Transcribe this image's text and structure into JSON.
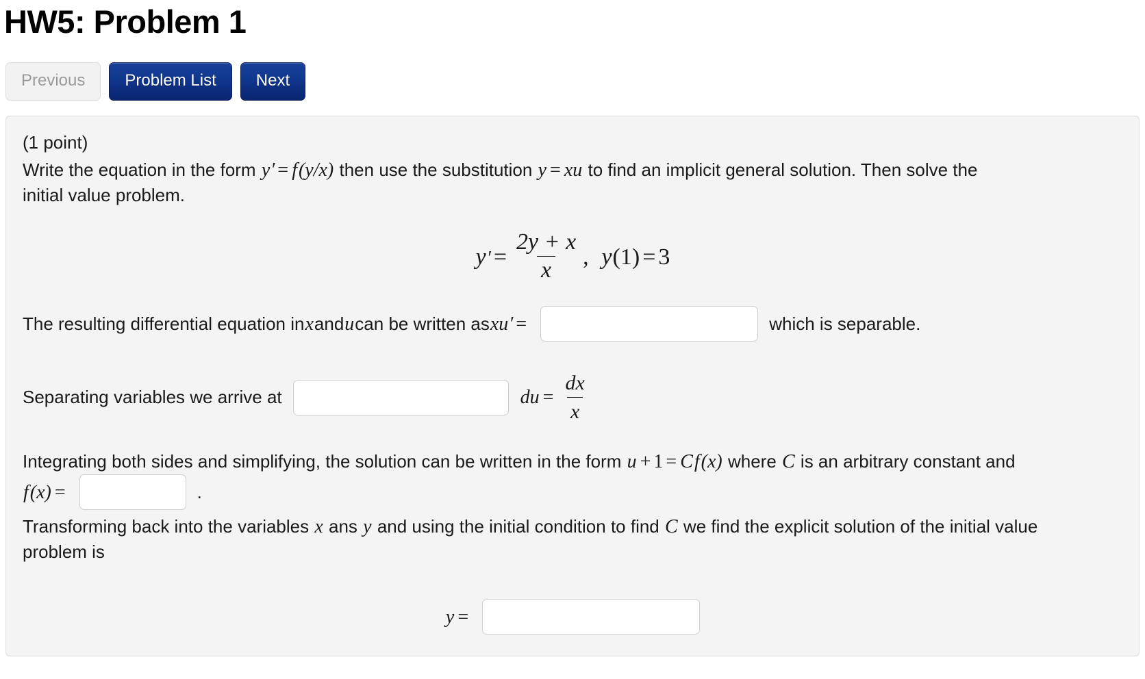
{
  "header": {
    "title": "HW5: Problem 1"
  },
  "nav": {
    "previous_label": "Previous",
    "problem_list_label": "Problem List",
    "next_label": "Next",
    "primary_color": "#0c2d80",
    "disabled_text_color": "#9b9b9b"
  },
  "problem": {
    "points": "(1 point)",
    "intro_part1": "Write the equation in the form ",
    "intro_math1_y": "y",
    "intro_math1_prime": "′",
    "intro_math1_eq": "=",
    "intro_math1_f": "f",
    "intro_math1_arg": "(y/x)",
    "intro_part2": " then use the substitution ",
    "intro_math2_y": "y",
    "intro_math2_eq": "=",
    "intro_math2_xu": "xu",
    "intro_part3": " to find an implicit general solution. Then solve the",
    "intro_part4": "initial value problem.",
    "equation": {
      "lhs_y": "y",
      "lhs_prime": "′",
      "eq": "=",
      "numerator": "2y + x",
      "denominator": "x",
      "comma": ",",
      "initial_condition_y": "y",
      "initial_condition_arg": "(1)",
      "initial_condition_eq": "=",
      "initial_condition_value": "3"
    },
    "resulting": {
      "text_before": "The resulting differential equation in ",
      "var_x": "x",
      "text_and": " and ",
      "var_u": "u",
      "text_mid": " can be written as ",
      "math_xu": "xu",
      "math_prime": "′",
      "math_eq": "=",
      "input_value": "",
      "input_placeholder": "",
      "text_after": "which is separable."
    },
    "separating": {
      "text_before": "Separating variables we arrive at",
      "input_value": "",
      "input_placeholder": "",
      "math_du": "du",
      "math_eq": "=",
      "frac_num": "dx",
      "frac_den": "x"
    },
    "integrating": {
      "text_before": "Integrating both sides and simplifying, the solution can be written in the form ",
      "math_u": "u",
      "math_plus": "+",
      "math_one": "1",
      "math_eq": "=",
      "math_C": "C",
      "math_f": "f",
      "math_arg": "(x)",
      "text_mid": " where ",
      "math_C2": "C",
      "text_after": " is an arbitrary constant and",
      "fx_label_f": "f",
      "fx_label_arg": "(x)",
      "fx_label_eq": "=",
      "fx_input_value": "",
      "fx_input_placeholder": "",
      "period": "."
    },
    "transforming": {
      "text_before": "Transforming back into the variables ",
      "var_x": "x",
      "text_ans": " ans ",
      "var_y": "y",
      "text_mid": " and using the initial condition to find ",
      "math_C": "C",
      "text_after": " we find the explicit solution of the initial value",
      "text_line2": "problem is"
    },
    "final_answer": {
      "label_y": "y",
      "label_eq": "=",
      "input_value": "",
      "input_placeholder": ""
    }
  }
}
